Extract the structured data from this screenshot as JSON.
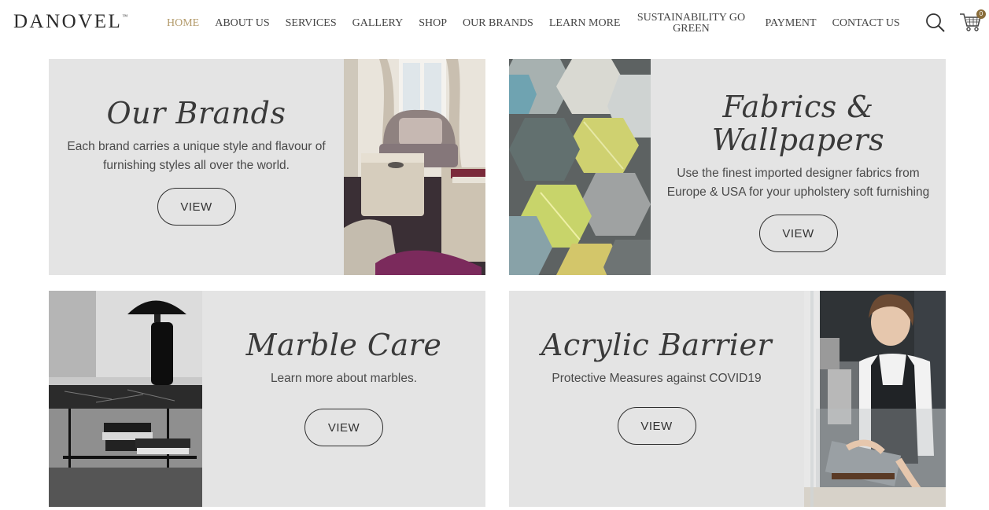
{
  "header": {
    "logo": "DANOVEL",
    "logo_tm": "™",
    "nav": [
      {
        "label": "HOME",
        "active": true
      },
      {
        "label": "ABOUT US"
      },
      {
        "label": "SERVICES"
      },
      {
        "label": "GALLERY"
      },
      {
        "label": "SHOP"
      },
      {
        "label": "OUR BRANDS"
      },
      {
        "label": "LEARN MORE"
      },
      {
        "label": "SUSTAINABILITY GO GREEN"
      },
      {
        "label": "PAYMENT"
      },
      {
        "label": "CONTACT US"
      }
    ],
    "search_icon": "search-icon",
    "cart_icon": "shopping-cart-icon",
    "cart_count": "0",
    "accent_color": "#b39a6a"
  },
  "cards": [
    {
      "title": "Our Brands",
      "desc": "Each brand carries a unique style and flavour of furnishing styles all over the world.",
      "button": "VIEW",
      "image": "living-room-armchair-photo"
    },
    {
      "title": "Fabrics & Wallpapers",
      "desc": "Use the finest imported designer fabrics from Europe & USA for your upholstery soft furnishing",
      "button": "VIEW",
      "image": "hexagon-fabric-samples-photo"
    },
    {
      "title": "Marble Care",
      "desc": "Learn more about marbles.",
      "button": "VIEW",
      "image": "marble-console-table-photo"
    },
    {
      "title": "Acrylic Barrier",
      "desc": "Protective Measures against COVID19",
      "button": "VIEW",
      "image": "barista-behind-acrylic-shield-photo"
    }
  ],
  "colors": {
    "card_bg": "#e4e4e4",
    "text": "#3a3a3a"
  }
}
